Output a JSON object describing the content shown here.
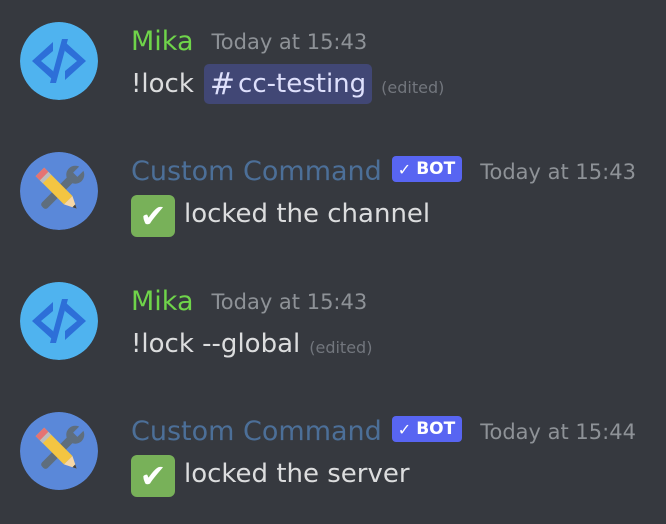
{
  "messages": [
    {
      "author": "Mika",
      "timestamp": "Today at 15:43",
      "text": "!lock",
      "mention": "cc-testing",
      "mention_prefix": "#",
      "edited": "(edited)"
    },
    {
      "author": "Custom Command",
      "bot_tag": "BOT",
      "bot_check": "✓",
      "timestamp": "Today at 15:43",
      "emoji": "✔",
      "text": "locked the channel"
    },
    {
      "author": "Mika",
      "timestamp": "Today at 15:43",
      "text": "!lock --global",
      "edited": "(edited)"
    },
    {
      "author": "Custom Command",
      "bot_tag": "BOT",
      "bot_check": "✓",
      "timestamp": "Today at 15:44",
      "emoji": "✔",
      "text": "locked the server"
    }
  ],
  "colors": {
    "background": "#36393f",
    "user_name": "#6fd44a",
    "bot_name": "#4c6f98",
    "bot_tag": "#5865f2",
    "mention_bg": "#414775",
    "check_emoji_bg": "#78b159",
    "timestamp": "#8e9297"
  },
  "icons": {
    "user_avatar": "code-brackets-icon",
    "bot_avatar": "pencil-wrench-icon"
  }
}
